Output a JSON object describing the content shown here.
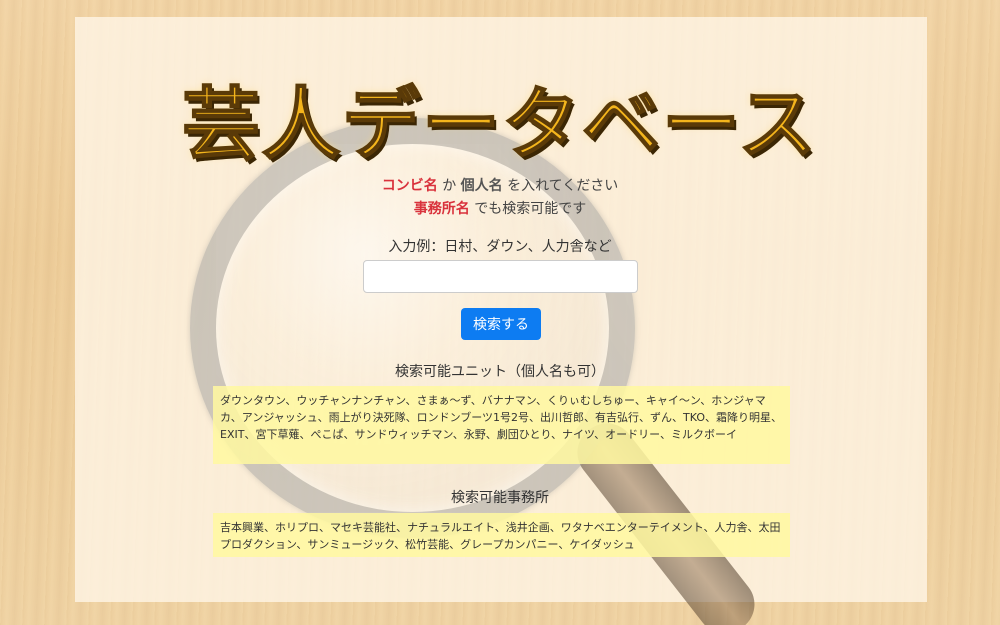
{
  "title": "芸人データベース",
  "intro": {
    "combi": "コンビ名",
    "ka": "か",
    "individual": "個人名",
    "enter": "を入れてください",
    "agency": "事務所名",
    "also_searchable": "でも検索可能です"
  },
  "example": "入力例：日村、ダウン、人力舎など",
  "search": {
    "value": "",
    "placeholder": "",
    "button_label": "検索する"
  },
  "units": {
    "heading": "検索可能ユニット（個人名も可）",
    "list": "ダウンタウン、ウッチャンナンチャン、さまぁ～ず、バナナマン、くりぃむしちゅー、キャイ～ン、ホンジャマカ、アンジャッシュ、雨上がり決死隊、ロンドンブーツ1号2号、出川哲郎、有吉弘行、ずん、TKO、霜降り明星、EXIT、宮下草薙、ぺこぱ、サンドウィッチマン、永野、劇団ひとり、ナイツ、オードリー、ミルクボーイ"
  },
  "agencies": {
    "heading": "検索可能事務所",
    "list": "吉本興業、ホリプロ、マセキ芸能社、ナチュラルエイト、浅井企画、ワタナベエンターテイメント、人力舎、太田プロダクション、サンミュージック、松竹芸能、グレープカンパニー、ケイダッシュ"
  },
  "colors": {
    "accent_red": "#d9323c",
    "button_blue": "#0d7cf2",
    "title_gold": "#f4b51c",
    "list_background": "#fff8a0"
  }
}
